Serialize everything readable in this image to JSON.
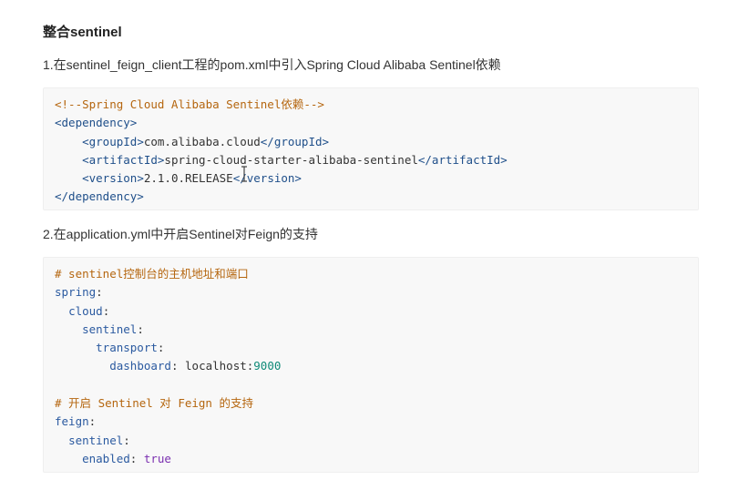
{
  "heading": "整合sentinel",
  "step1": "1.在sentinel_feign_client工程的pom.xml中引入Spring Cloud Alibaba Sentinel依赖",
  "step2": "2.在application.yml中开启Sentinel对Feign的支持",
  "xml": {
    "comment": "<!--Spring Cloud Alibaba Sentinel依赖-->",
    "dep_open": "<dependency>",
    "group_open": "<groupId>",
    "group_value": "com.alibaba.cloud",
    "group_close": "</groupId>",
    "artifact_open": "<artifactId>",
    "artifact_value": "spring-cloud-starter-alibaba-sentinel",
    "artifact_close": "</artifactId>",
    "version_open": "<version>",
    "version_value": "2.1.0.RELEASE",
    "version_close": "</version>",
    "dep_close": "</dependency>"
  },
  "yaml": {
    "comment1": "# sentinel控制台的主机地址和端口",
    "spring": "spring",
    "cloud": "cloud",
    "sentinel": "sentinel",
    "transport": "transport",
    "dashboard_key": "dashboard",
    "dashboard_host": "localhost",
    "dashboard_sep": ":",
    "dashboard_port": "9000",
    "comment2": "# 开启 Sentinel 对 Feign 的支持",
    "feign": "feign",
    "feign_sentinel": "sentinel",
    "enabled_key": "enabled",
    "enabled_value": "true"
  },
  "colors": {
    "comment": "#b5660f",
    "tag": "#1f4f8a",
    "number": "#0f8a78",
    "keyword": "#7a2fb0",
    "code_bg": "#f8f8f8"
  },
  "icons": {
    "cursor": "text-cursor-icon"
  }
}
